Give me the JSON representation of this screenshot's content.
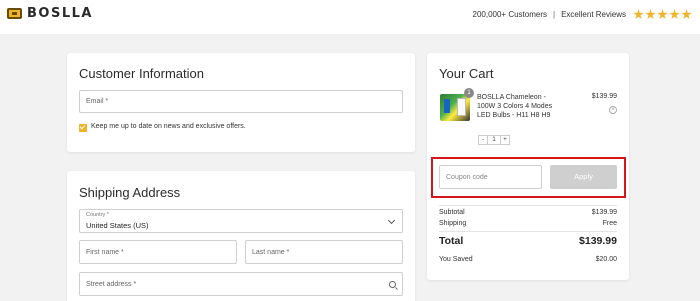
{
  "header": {
    "brand": "BOSLLA",
    "customers": "200,000+ Customers",
    "separator": "|",
    "reviews": "Excellent Reviews",
    "rating_stars": 5
  },
  "customer": {
    "title": "Customer Information",
    "email_placeholder": "Email *",
    "newsletter_label": "Keep me up to date on news and exclusive offers.",
    "newsletter_checked": true
  },
  "shipping": {
    "title": "Shipping Address",
    "country_label": "Country *",
    "country_value": "United States (US)",
    "first_name_placeholder": "First name *",
    "last_name_placeholder": "Last name *",
    "street_placeholder": "Street address *"
  },
  "cart": {
    "title": "Your Cart",
    "item": {
      "quantity_badge": "1",
      "name": "BOSLLA Chameleon - 100W 3 Colors 4 Modes LED Bulbs - H11 H8 H9",
      "price": "$139.99",
      "stepper_minus": "-",
      "stepper_qty": "1",
      "stepper_plus": "+",
      "remove_symbol": "×"
    },
    "coupon_placeholder": "Coupon code",
    "apply_label": "Apply",
    "summary": {
      "subtotal_label": "Subtotal",
      "subtotal_value": "$139.99",
      "shipping_label": "Shipping",
      "shipping_value": "Free",
      "total_label": "Total",
      "total_value": "$139.99",
      "saved_label": "You Saved",
      "saved_value": "$20.00"
    }
  },
  "colors": {
    "accent": "#f0b429",
    "highlight_border": "#d6161d",
    "background": "#f2f2f2"
  }
}
